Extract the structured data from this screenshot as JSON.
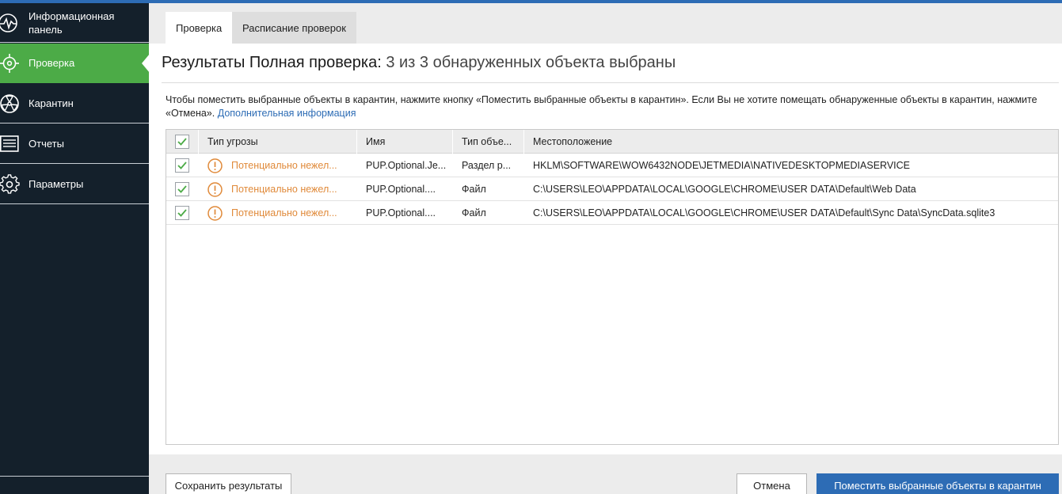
{
  "sidebar": {
    "items": [
      {
        "label": "Информационная панель",
        "icon": "dashboard-pulse-icon"
      },
      {
        "label": "Проверка",
        "icon": "scan-target-icon",
        "active": true
      },
      {
        "label": "Карантин",
        "icon": "quarantine-biohazard-icon"
      },
      {
        "label": "Отчеты",
        "icon": "reports-list-icon"
      },
      {
        "label": "Параметры",
        "icon": "settings-gear-icon"
      }
    ]
  },
  "tabs": [
    {
      "label": "Проверка",
      "active": true
    },
    {
      "label": "Расписание проверок",
      "active": false
    }
  ],
  "title": {
    "strong": "Результаты Полная проверка:",
    "light": "3 из 3 обнаруженных объекта выбраны"
  },
  "info": {
    "text": "Чтобы поместить выбранные объекты в карантин, нажмите кнопку «Поместить выбранные объекты в карантин». Если Вы не хотите помещать обнаруженные объекты в карантин, нажмите «Отмена».",
    "link": "Дополнительная информация"
  },
  "table": {
    "headers": [
      "Тип угрозы",
      "Имя",
      "Тип объе...",
      "Местоположение"
    ],
    "rows": [
      {
        "checked": true,
        "threat": "Потенциально нежел...",
        "name": "PUP.Optional.Je...",
        "type": "Раздел р...",
        "location": "HKLM\\SOFTWARE\\WOW6432NODE\\JETMEDIA\\NATIVEDESKTOPMEDIASERVICE"
      },
      {
        "checked": true,
        "threat": "Потенциально нежел...",
        "name": "PUP.Optional....",
        "type": "Файл",
        "location": "C:\\USERS\\LEO\\APPDATA\\LOCAL\\GOOGLE\\CHROME\\USER DATA\\Default\\Web Data"
      },
      {
        "checked": true,
        "threat": "Потенциально нежел...",
        "name": "PUP.Optional....",
        "type": "Файл",
        "location": "C:\\USERS\\LEO\\APPDATA\\LOCAL\\GOOGLE\\CHROME\\USER DATA\\Default\\Sync Data\\SyncData.sqlite3"
      }
    ]
  },
  "footer": {
    "save": "Сохранить результаты",
    "cancel": "Отмена",
    "quarantine": "Поместить выбранные объекты в карантин"
  },
  "colors": {
    "sidebar_bg": "#14202b",
    "active_green": "#4cab47",
    "accent_blue": "#2d6cb5",
    "threat_orange": "#e08a3a"
  }
}
